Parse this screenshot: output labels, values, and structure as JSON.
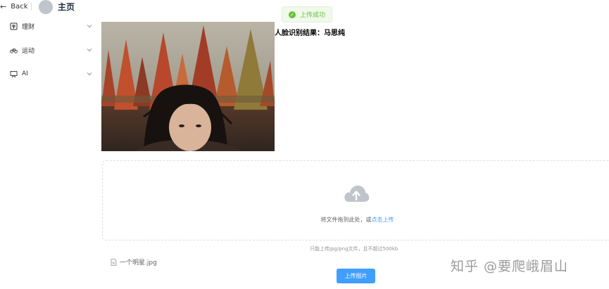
{
  "header": {
    "back_label": "Back",
    "title": "主页"
  },
  "sidebar": {
    "items": [
      {
        "label": "理财",
        "icon": "finance-icon"
      },
      {
        "label": "运动",
        "icon": "bicycle-icon"
      },
      {
        "label": "AI",
        "icon": "ai-screen-icon"
      }
    ]
  },
  "toast": {
    "message": "上传成功",
    "color": "#67c23a"
  },
  "result": {
    "text": "人脸识别结果：马思纯"
  },
  "uploader": {
    "drag_text": "将文件拖到此处，或",
    "click_text": "点击上传",
    "tip": "只能上传jpg/png文件，且不超过500kb",
    "file_name": "一个明星.jpg",
    "button_label": "上传图片",
    "accent": "#409eff"
  },
  "watermark": {
    "text": "知乎 @要爬峨眉山"
  }
}
